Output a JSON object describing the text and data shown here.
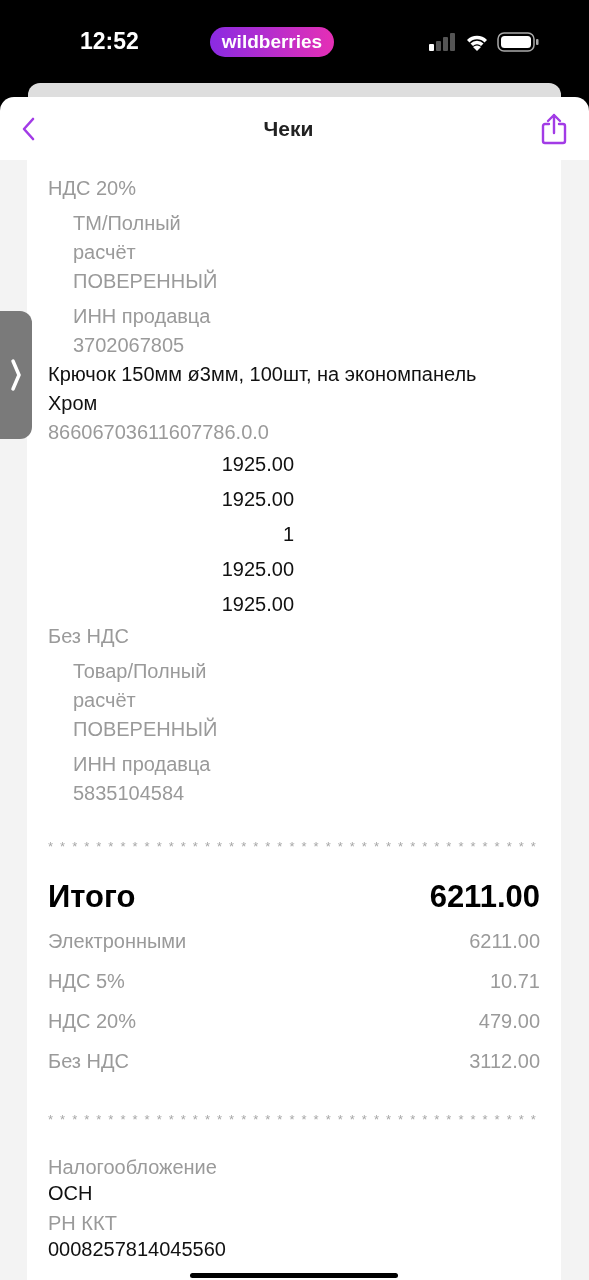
{
  "status_bar": {
    "time": "12:52",
    "app_badge": "wildberries"
  },
  "nav": {
    "title": "Чеки"
  },
  "receipt": {
    "lines": [
      {
        "kind": "label",
        "text": "НДС 20%"
      },
      {
        "kind": "detail",
        "text": "ТМ/Полный расчёт ПОВЕРЕННЫЙ"
      },
      {
        "kind": "detail",
        "text": "ИНН продавца 3702067805"
      },
      {
        "kind": "name",
        "text": "Крючок 150мм ø3мм, 100шт, на экономпанель Хром"
      },
      {
        "kind": "label",
        "text": "86606703611607786.0.0"
      },
      {
        "kind": "amount",
        "text": "1925.00"
      },
      {
        "kind": "amount",
        "text": "1925.00"
      },
      {
        "kind": "amount",
        "text": "1"
      },
      {
        "kind": "amount",
        "text": "1925.00"
      },
      {
        "kind": "amount",
        "text": "1925.00"
      },
      {
        "kind": "label",
        "text": "Без НДС"
      },
      {
        "kind": "detail",
        "text": "Товар/Полный расчёт ПОВЕРЕННЫЙ"
      },
      {
        "kind": "detail",
        "text": "ИНН продавца 5835104584"
      },
      {
        "kind": "separator",
        "text": "* * * * * * * * * * * * * * * * * * * * * * * * * * * * * * * * * * * * * * * * *"
      },
      {
        "kind": "total",
        "text": "Итого",
        "value": "6211.00"
      },
      {
        "kind": "summary",
        "text": "Электронными",
        "value": "6211.00"
      },
      {
        "kind": "summary",
        "text": "НДС 5%",
        "value": "10.71"
      },
      {
        "kind": "summary",
        "text": "НДС 20%",
        "value": "479.00"
      },
      {
        "kind": "summary",
        "text": "Без НДС",
        "value": "3112.00"
      },
      {
        "kind": "separator",
        "text": "* * * * * * * * * * * * * * * * * * * * * * * * * * * * * * * * * * * * * * * * *"
      },
      {
        "kind": "field",
        "text": "Налогообложение",
        "value": "ОСН"
      },
      {
        "kind": "field",
        "text": "РН ККТ",
        "value": "0008257814045560"
      }
    ]
  }
}
